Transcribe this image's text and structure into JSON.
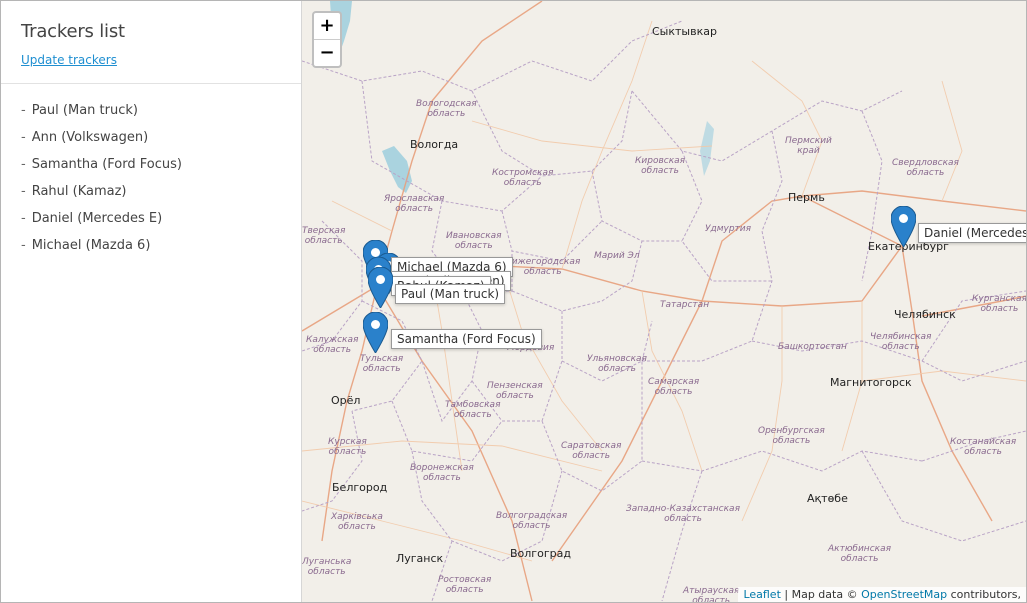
{
  "sidebar": {
    "title": "Trackers list",
    "update_link": "Update trackers",
    "items": [
      {
        "label": "Paul (Man truck)"
      },
      {
        "label": "Ann (Volkswagen)"
      },
      {
        "label": "Samantha (Ford Focus)"
      },
      {
        "label": "Rahul (Kamaz)"
      },
      {
        "label": "Daniel (Mercedes E)"
      },
      {
        "label": "Michael (Mazda 6)"
      }
    ]
  },
  "map": {
    "zoom_in": "+",
    "zoom_out": "−",
    "marker_labels": {
      "michael": "Michael (Mazda 6)",
      "ann": "Ann (Volkswagen)",
      "rahul": "Rahul (Kamaz)",
      "paul": "Paul (Man truck)",
      "samantha": "Samantha (Ford Focus)",
      "daniel": "Daniel (Mercedes E)"
    },
    "cities": {
      "syktyvkar": "Сыктывкар",
      "vologda": "Вологда",
      "perm": "Пермь",
      "ekaterinburg": "Екатеринбург",
      "chelyabinsk": "Челябинск",
      "magnitogorsk": "Магнитогорск",
      "orel": "Орёл",
      "belgorod": "Белгород",
      "lugansk": "Луганск",
      "volgograd": "Волгоград",
      "aktobe": "Ақтөбе"
    },
    "regions": {
      "vologodskaya": "Вологодская\nобласть",
      "kostromskaya": "Костромская\nобласть",
      "kirovskaya": "Кировская\nобласть",
      "permsky": "Пермский\nкрай",
      "sverdlovskaya": "Свердловская\nобласть",
      "yaroslavskaya": "Ярославская\nобласть",
      "ivanovskaya": "Ивановская\nобласть",
      "nizhegorodskaya": "Нижегородская\nобласть",
      "mariy_el": "Марий Эл",
      "udmurtia": "Удмуртия",
      "tverskaya": "Тверская\nобласть",
      "tatarstan": "Татарстан",
      "kurganskaya": "Курганская\nобласть",
      "chelyabinskaya": "Челябинская\nобласть",
      "bashkortostan": "Башкортостан",
      "kaluzhskaya": "Калужская\nобласть",
      "tulskaya": "Тульская\nобласть",
      "mordovia": "Мордовия",
      "ulyanovskaya": "Ульяновская\nобласть",
      "penzenskaya": "Пензенская\nобласть",
      "samarskaya": "Самарская\nобласть",
      "orenburgskaya": "Оренбургская\nобласть",
      "tambovskaya": "Тамбовская\nобласть",
      "kurskaya": "Курская\nобласть",
      "saratovskaya": "Саратовская\nобласть",
      "kostanayskaya": "Костанайская\nобласть",
      "voronezhskaya": "Воронежская\nобласть",
      "kharkivska": "Харківська\nобласть",
      "volgogradskaya": "Волгоградская\nобласть",
      "zapadno_kaz": "Западно-Казахстанская\nобласть",
      "aktyubinskaya": "Актюбинская\nобласть",
      "luhanska": "Луганська\nобласть",
      "rostovskaya": "Ростовская\nобласть",
      "atyrauskaya": "Атырауская\nобласть"
    },
    "attribution": {
      "leaflet": "Leaflet",
      "sep": " | Map data © ",
      "osm": "OpenStreetMap",
      "tail": " contributors,"
    },
    "colors": {
      "water": "#aad3df",
      "land": "#f2efe9",
      "border": "#b9a3c6",
      "road_main": "#e8a07c",
      "road_minor": "#f2c9a8",
      "marker": "#2a81cb"
    }
  }
}
